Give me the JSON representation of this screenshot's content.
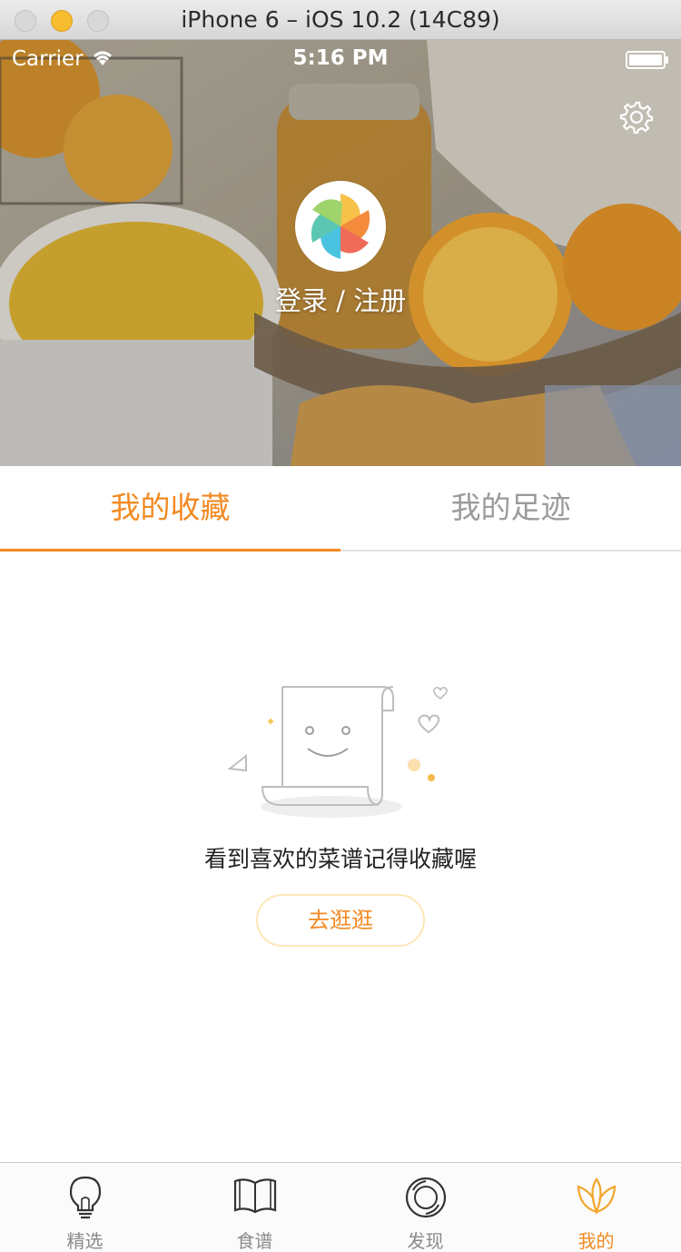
{
  "window": {
    "title": "iPhone 6 – iOS 10.2 (14C89)"
  },
  "status_bar": {
    "carrier": "Carrier",
    "time": "5:16 PM",
    "icons": [
      "wifi-icon",
      "battery-icon"
    ]
  },
  "header": {
    "settings_icon": "gear-icon",
    "avatar_icon": "pinwheel-logo",
    "login_label": "登录 / 注册"
  },
  "tabs": [
    {
      "label": "我的收藏",
      "active": true
    },
    {
      "label": "我的足迹",
      "active": false
    }
  ],
  "empty_state": {
    "illustration": "recipe-scroll-illustration",
    "message": "看到喜欢的菜谱记得收藏喔",
    "button_label": "去逛逛"
  },
  "tab_bar": {
    "items": [
      {
        "label": "精选",
        "icon": "lightbulb-icon",
        "selected": false
      },
      {
        "label": "食谱",
        "icon": "book-icon",
        "selected": false
      },
      {
        "label": "发现",
        "icon": "lens-icon",
        "selected": false
      },
      {
        "label": "我的",
        "icon": "lotus-icon",
        "selected": true
      }
    ]
  },
  "colors": {
    "accent": "#f28a22",
    "inactive_text": "#9a9a9a",
    "button_border": "#fde7b8"
  }
}
